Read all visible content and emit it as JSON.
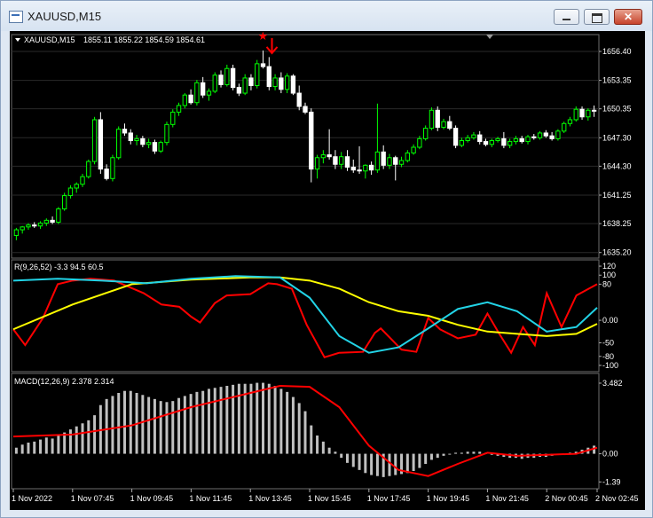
{
  "window": {
    "title": "XAUUSD,M15",
    "minimize_glyph": "—",
    "maximize_glyph": "□",
    "close_glyph": "✕"
  },
  "colors": {
    "background": "#000000",
    "grid": "#2a2a2a",
    "text": "#ffffff",
    "candle_bull": "#00ff00",
    "candle_bear": "#ffffff",
    "rsi_red": "#ff0000",
    "rsi_yellow": "#ffff00",
    "rsi_cyan": "#22d3e6",
    "macd_hist": "#c0c0c0",
    "macd_signal": "#ff0000",
    "signal_marker": "#ff0000"
  },
  "chart_data": [
    {
      "type": "candlestick",
      "label": "XAUUSD,M15",
      "ohlc_label": "1855.11 1855.22 1854.59 1854.61",
      "price_ticks": [
        "1656.40",
        "1653.35",
        "1650.35",
        "1647.30",
        "1644.30",
        "1641.25",
        "1638.25",
        "1635.20"
      ],
      "price_tick_values": [
        1656.4,
        1653.35,
        1650.35,
        1647.3,
        1644.3,
        1641.25,
        1638.25,
        1635.2
      ],
      "ylim": [
        1634.8,
        1657.8
      ],
      "candles": [
        [
          1637.0,
          1637.8,
          1636.5,
          1637.6
        ],
        [
          1637.6,
          1638.0,
          1637.2,
          1637.9
        ],
        [
          1637.9,
          1638.3,
          1637.6,
          1638.1
        ],
        [
          1638.1,
          1638.4,
          1637.8,
          1638.0
        ],
        [
          1638.0,
          1638.5,
          1637.7,
          1638.3
        ],
        [
          1638.3,
          1638.8,
          1638.0,
          1638.6
        ],
        [
          1638.6,
          1639.0,
          1638.2,
          1638.4
        ],
        [
          1638.4,
          1640.0,
          1638.2,
          1639.8
        ],
        [
          1639.8,
          1641.5,
          1639.6,
          1641.2
        ],
        [
          1641.2,
          1642.3,
          1640.9,
          1642.0
        ],
        [
          1642.0,
          1642.6,
          1641.5,
          1642.4
        ],
        [
          1642.4,
          1643.5,
          1642.1,
          1643.2
        ],
        [
          1643.2,
          1645.0,
          1643.0,
          1644.8
        ],
        [
          1644.8,
          1649.5,
          1644.5,
          1649.2
        ],
        [
          1649.2,
          1650.0,
          1643.5,
          1644.0
        ],
        [
          1644.0,
          1644.5,
          1642.8,
          1643.0
        ],
        [
          1643.0,
          1645.5,
          1642.7,
          1645.2
        ],
        [
          1645.2,
          1648.5,
          1645.0,
          1648.2
        ],
        [
          1648.2,
          1648.8,
          1647.5,
          1647.8
        ],
        [
          1647.8,
          1648.2,
          1646.6,
          1647.0
        ],
        [
          1647.0,
          1647.6,
          1646.5,
          1647.2
        ],
        [
          1647.2,
          1647.5,
          1646.3,
          1646.6
        ],
        [
          1646.6,
          1647.2,
          1646.2,
          1646.8
        ],
        [
          1646.8,
          1647.1,
          1645.6,
          1645.9
        ],
        [
          1645.9,
          1647.0,
          1645.7,
          1646.8
        ],
        [
          1646.8,
          1649.0,
          1646.5,
          1648.7
        ],
        [
          1648.7,
          1650.3,
          1648.4,
          1650.0
        ],
        [
          1650.0,
          1651.0,
          1649.6,
          1650.7
        ],
        [
          1650.7,
          1652.0,
          1650.4,
          1651.8
        ],
        [
          1651.8,
          1652.4,
          1650.8,
          1651.0
        ],
        [
          1651.0,
          1653.4,
          1650.7,
          1653.1
        ],
        [
          1653.1,
          1653.7,
          1651.5,
          1651.8
        ],
        [
          1651.8,
          1652.5,
          1651.2,
          1652.2
        ],
        [
          1652.2,
          1654.2,
          1652.0,
          1653.9
        ],
        [
          1653.9,
          1654.4,
          1652.6,
          1652.9
        ],
        [
          1652.9,
          1655.0,
          1652.7,
          1654.6
        ],
        [
          1654.6,
          1655.0,
          1652.3,
          1652.6
        ],
        [
          1652.6,
          1653.0,
          1651.7,
          1652.0
        ],
        [
          1652.0,
          1654.0,
          1651.8,
          1653.6
        ],
        [
          1653.6,
          1654.0,
          1652.3,
          1652.8
        ],
        [
          1652.8,
          1655.5,
          1652.5,
          1655.1
        ],
        [
          1655.1,
          1656.5,
          1654.6,
          1654.8
        ],
        [
          1654.8,
          1655.8,
          1652.3,
          1652.7
        ],
        [
          1652.7,
          1654.0,
          1652.3,
          1653.6
        ],
        [
          1653.6,
          1654.2,
          1652.0,
          1652.4
        ],
        [
          1652.4,
          1654.1,
          1652.0,
          1653.8
        ],
        [
          1653.8,
          1654.0,
          1651.8,
          1652.0
        ],
        [
          1652.0,
          1652.8,
          1650.2,
          1650.6
        ],
        [
          1650.6,
          1651.0,
          1649.8,
          1650.0
        ],
        [
          1650.0,
          1650.4,
          1642.6,
          1644.0
        ],
        [
          1644.0,
          1645.5,
          1643.0,
          1645.2
        ],
        [
          1645.2,
          1646.0,
          1644.6,
          1645.5
        ],
        [
          1645.5,
          1648.2,
          1645.0,
          1645.3
        ],
        [
          1645.3,
          1646.0,
          1644.0,
          1644.5
        ],
        [
          1644.5,
          1645.8,
          1644.0,
          1645.3
        ],
        [
          1645.3,
          1646.0,
          1643.8,
          1644.2
        ],
        [
          1644.2,
          1645.0,
          1643.6,
          1643.9
        ],
        [
          1643.9,
          1646.4,
          1643.5,
          1643.8
        ],
        [
          1643.8,
          1644.5,
          1643.0,
          1644.4
        ],
        [
          1644.4,
          1644.8,
          1643.4,
          1643.9
        ],
        [
          1643.9,
          1650.9,
          1643.6,
          1645.8
        ],
        [
          1645.8,
          1646.5,
          1644.0,
          1644.4
        ],
        [
          1644.4,
          1645.6,
          1644.0,
          1645.2
        ],
        [
          1645.2,
          1645.4,
          1642.8,
          1644.5
        ],
        [
          1644.5,
          1645.3,
          1644.2,
          1644.9
        ],
        [
          1644.9,
          1646.0,
          1644.7,
          1645.7
        ],
        [
          1645.7,
          1646.6,
          1645.5,
          1646.3
        ],
        [
          1646.3,
          1647.5,
          1646.1,
          1647.2
        ],
        [
          1647.2,
          1648.6,
          1647.0,
          1648.3
        ],
        [
          1648.3,
          1650.5,
          1648.1,
          1650.2
        ],
        [
          1650.2,
          1650.6,
          1648.0,
          1648.4
        ],
        [
          1648.4,
          1649.3,
          1648.2,
          1649.0
        ],
        [
          1649.0,
          1649.6,
          1648.1,
          1648.3
        ],
        [
          1648.3,
          1648.6,
          1646.2,
          1646.5
        ],
        [
          1646.5,
          1647.3,
          1646.3,
          1647.0
        ],
        [
          1647.0,
          1647.6,
          1646.8,
          1647.3
        ],
        [
          1647.3,
          1647.9,
          1647.1,
          1647.6
        ],
        [
          1647.6,
          1648.0,
          1646.6,
          1646.9
        ],
        [
          1646.9,
          1647.2,
          1646.4,
          1646.6
        ],
        [
          1646.6,
          1647.2,
          1646.3,
          1647.0
        ],
        [
          1647.0,
          1647.4,
          1646.8,
          1647.2
        ],
        [
          1647.2,
          1647.9,
          1646.2,
          1646.5
        ],
        [
          1646.5,
          1647.2,
          1646.2,
          1646.9
        ],
        [
          1646.9,
          1647.5,
          1646.6,
          1647.2
        ],
        [
          1647.2,
          1647.5,
          1646.7,
          1646.9
        ],
        [
          1646.9,
          1647.6,
          1646.6,
          1647.4
        ],
        [
          1647.4,
          1647.7,
          1647.1,
          1647.3
        ],
        [
          1647.3,
          1648.0,
          1647.1,
          1647.8
        ],
        [
          1647.8,
          1648.1,
          1647.3,
          1647.5
        ],
        [
          1647.5,
          1647.9,
          1647.0,
          1647.2
        ],
        [
          1647.2,
          1648.2,
          1647.0,
          1648.0
        ],
        [
          1648.0,
          1649.0,
          1647.8,
          1648.8
        ],
        [
          1648.8,
          1649.5,
          1648.5,
          1649.2
        ],
        [
          1649.2,
          1650.6,
          1649.0,
          1650.3
        ],
        [
          1650.3,
          1650.6,
          1649.2,
          1649.5
        ],
        [
          1649.5,
          1650.4,
          1649.1,
          1650.2
        ],
        [
          1650.2,
          1650.7,
          1649.5,
          1650.1
        ]
      ],
      "marker_candle": 41
    },
    {
      "type": "line",
      "label": "R(9,26,52) -3.3 94.5 60.5",
      "ticks": [
        "120",
        "100",
        "80",
        "0.00",
        "-50",
        "-80",
        "-100"
      ],
      "tick_values": [
        120,
        100,
        80,
        0,
        -50,
        -80,
        -100
      ],
      "ylim": [
        -106,
        126
      ],
      "series": [
        {
          "color": "#ff0000",
          "x": [
            0,
            4,
            10,
            15,
            20,
            26,
            34,
            44,
            50,
            56,
            60,
            63,
            68,
            72,
            80,
            86,
            89,
            94,
            99,
            105,
            110,
            118,
            122,
            124,
            131,
            136,
            140,
            144,
            150,
            156,
            160,
            164,
            168,
            172,
            176,
            180,
            185,
            190,
            197
          ],
          "y": [
            -20,
            -55,
            5,
            80,
            88,
            92,
            88,
            60,
            35,
            30,
            8,
            -5,
            38,
            55,
            58,
            82,
            80,
            70,
            -10,
            -82,
            -72,
            -70,
            -28,
            -18,
            -65,
            -70,
            5,
            -20,
            -40,
            -32,
            15,
            -30,
            -72,
            -15,
            -55,
            60,
            -15,
            55,
            80
          ]
        },
        {
          "color": "#ffff00",
          "x": [
            0,
            20,
            40,
            60,
            80,
            90,
            100,
            110,
            120,
            130,
            140,
            150,
            160,
            170,
            180,
            190,
            197
          ],
          "y": [
            -20,
            35,
            80,
            90,
            95,
            95,
            88,
            70,
            40,
            20,
            10,
            -10,
            -25,
            -30,
            -35,
            -30,
            -8
          ]
        },
        {
          "color": "#22d3e6",
          "x": [
            0,
            15,
            30,
            45,
            60,
            75,
            90,
            100,
            110,
            120,
            130,
            140,
            150,
            160,
            170,
            180,
            190,
            197
          ],
          "y": [
            88,
            92,
            88,
            82,
            92,
            98,
            95,
            50,
            -35,
            -72,
            -60,
            -18,
            25,
            40,
            20,
            -25,
            -15,
            28
          ]
        }
      ]
    },
    {
      "type": "bar+line",
      "label": "MACD(12,26,9) 2.378 2.314",
      "ticks": [
        "3.482",
        "0.00",
        "-1.39"
      ],
      "tick_values": [
        3.482,
        0,
        -1.39
      ],
      "ylim": [
        -1.55,
        3.7
      ],
      "histogram": [
        0.3,
        0.45,
        0.55,
        0.6,
        0.7,
        0.8,
        0.75,
        0.9,
        1.05,
        1.2,
        1.35,
        1.5,
        1.65,
        1.9,
        2.4,
        2.7,
        2.85,
        3.0,
        3.1,
        3.1,
        3.0,
        2.9,
        2.8,
        2.7,
        2.6,
        2.55,
        2.6,
        2.75,
        2.85,
        2.95,
        3.05,
        3.1,
        3.2,
        3.25,
        3.3,
        3.35,
        3.4,
        3.45,
        3.45,
        3.45,
        3.5,
        3.5,
        3.45,
        3.35,
        3.2,
        3.05,
        2.8,
        2.5,
        2.1,
        1.4,
        0.9,
        0.6,
        0.3,
        0.1,
        -0.2,
        -0.45,
        -0.65,
        -0.8,
        -0.95,
        -1.05,
        -1.1,
        -1.15,
        -1.1,
        -1.05,
        -1.0,
        -0.95,
        -0.85,
        -0.7,
        -0.5,
        -0.3,
        -0.2,
        -0.1,
        0.0,
        0.05,
        0.05,
        0.1,
        0.1,
        0.1,
        0.05,
        -0.05,
        -0.1,
        -0.15,
        -0.2,
        -0.2,
        -0.25,
        -0.2,
        -0.2,
        -0.15,
        -0.15,
        -0.1,
        -0.05,
        0.0,
        0.05,
        0.1,
        0.2,
        0.3,
        0.4
      ],
      "signal_line": {
        "x": [
          0,
          20,
          40,
          60,
          80,
          90,
          100,
          110,
          120,
          130,
          140,
          150,
          160,
          170,
          180,
          190,
          197
        ],
        "y": [
          0.85,
          0.95,
          1.4,
          2.3,
          3.0,
          3.35,
          3.3,
          2.3,
          0.4,
          -0.8,
          -1.1,
          -0.5,
          0.05,
          -0.1,
          -0.05,
          0.0,
          0.3
        ]
      }
    }
  ],
  "time_axis": {
    "labels": [
      "1 Nov 2022",
      "1 Nov 07:45",
      "1 Nov 09:45",
      "1 Nov 11:45",
      "1 Nov 13:45",
      "1 Nov 15:45",
      "1 Nov 17:45",
      "1 Nov 19:45",
      "1 Nov 21:45",
      "2 Nov 00:45",
      "2 Nov 02:45"
    ],
    "label_positions": [
      0,
      20,
      40,
      60,
      80,
      100,
      120,
      140,
      160,
      180,
      197
    ]
  }
}
